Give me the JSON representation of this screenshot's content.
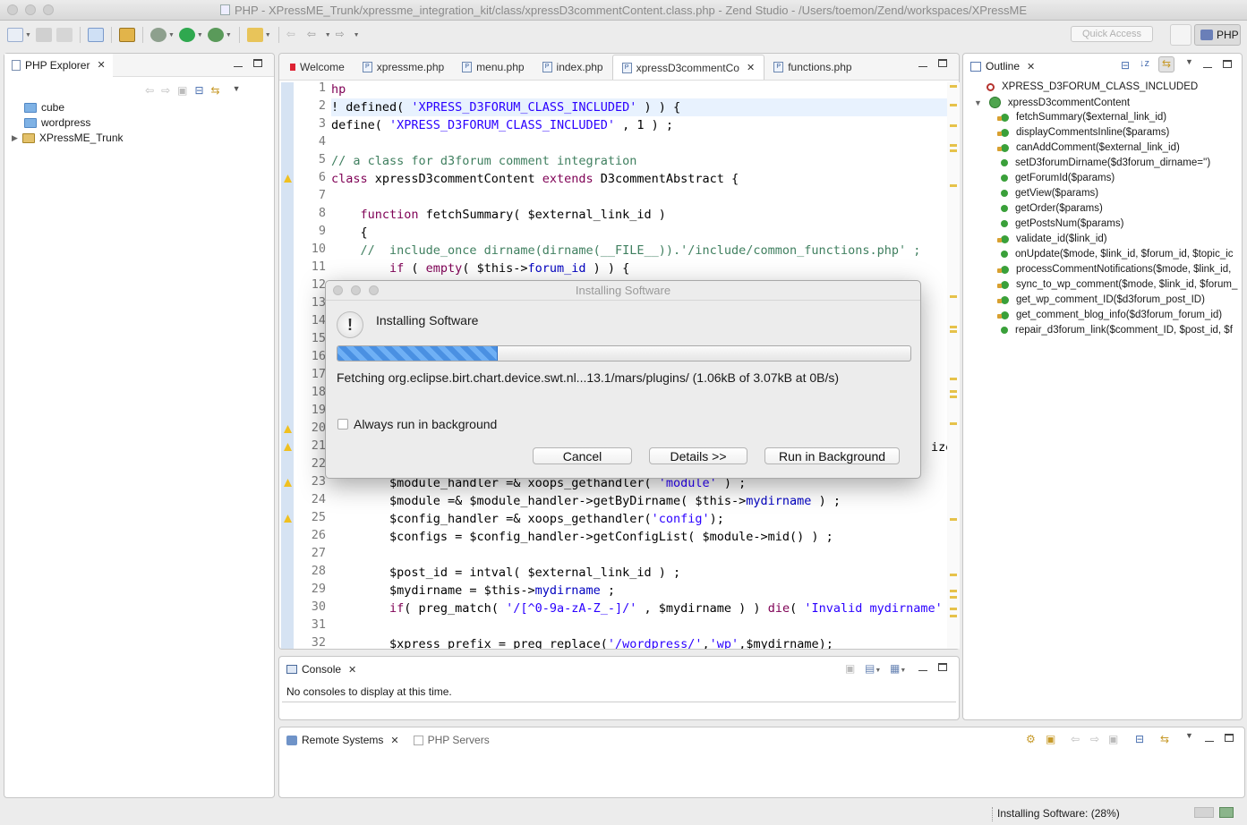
{
  "window": {
    "title": "PHP - XPressME_Trunk/xpressme_integration_kit/class/xpressD3commentContent.class.php - Zend Studio - /Users/toemon/Zend/workspaces/XPressME"
  },
  "toolbar": {
    "quick_access_placeholder": "Quick Access",
    "perspective_label": "PHP"
  },
  "explorer": {
    "tab_label": "PHP Explorer",
    "items": [
      {
        "label": "cube",
        "icon": "folder-icon"
      },
      {
        "label": "wordpress",
        "icon": "folder-icon"
      },
      {
        "label": "XPressME_Trunk",
        "icon": "project-icon"
      }
    ]
  },
  "editor": {
    "tabs": [
      {
        "label": "Welcome"
      },
      {
        "label": "xpressme.php"
      },
      {
        "label": "menu.php"
      },
      {
        "label": "index.php"
      },
      {
        "label": "xpressD3commentCo",
        "active": true
      },
      {
        "label": "functions.php"
      }
    ],
    "line_numbers": [
      "1",
      "2",
      "3",
      "4",
      "5",
      "6",
      "7",
      "8",
      "9",
      "10",
      "11",
      "12",
      "13",
      "14",
      "15",
      "16",
      "17",
      "18",
      "19",
      "20",
      "21",
      "22",
      "23",
      "24",
      "25",
      "26",
      "27",
      "28",
      "29",
      "30",
      "31",
      "32"
    ],
    "code": {
      "l1": "hp",
      "l2a": "! defined( ",
      "l2b": "'XPRESS_D3FORUM_CLASS_INCLUDED'",
      "l2c": " ) ) {",
      "l3a": "define( ",
      "l3b": "'XPRESS_D3FORUM_CLASS_INCLUDED'",
      "l3c": " , 1 ) ;",
      "l5": "// a class for d3forum comment integration",
      "l6a": "class",
      "l6b": " xpressD3commentContent ",
      "l6c": "extends",
      "l6d": " D3commentAbstract {",
      "l8a": "    function",
      "l8b": " fetchSummary( $external_link_id )",
      "l9": "    {",
      "l10": "    //  include_once dirname(dirname(__FILE__)).'/include/common_functions.php' ;",
      "l11a": "        if",
      "l11b": " ( ",
      "l11c": "empty",
      "l11d": "( $this->",
      "l11e": "forum_id",
      "l11f": " ) ) {",
      "l21tail": "izer",
      "l23a": "        $module_handler =& xoops_gethandler( ",
      "l23b": "'module'",
      "l23c": " ) ;",
      "l24a": "        $module =& $module_handler->getByDirname( $this->",
      "l24b": "mydirname",
      "l24c": " ) ;",
      "l25a": "        $config_handler =& xoops_gethandler(",
      "l25b": "'config'",
      "l25c": ");",
      "l26": "        $configs = $config_handler->getConfigList( $module->mid() ) ;",
      "l28": "        $post_id = intval( $external_link_id ) ;",
      "l29a": "        $mydirname = $this->",
      "l29b": "mydirname",
      "l29c": " ;",
      "l30a": "        if",
      "l30b": "( preg_match( ",
      "l30c": "'/[^0-9a-zA-Z_-]/'",
      "l30d": " , $mydirname ) ) ",
      "l30e": "die",
      "l30f": "( ",
      "l30g": "'Invalid mydirname'",
      "l30h": " )",
      "l32a": "        $xpress_prefix = preg_replace(",
      "l32b": "'/wordpress/'",
      "l32c": ",",
      "l32d": "'wp'",
      "l32e": ",$mydirname);"
    }
  },
  "console": {
    "tab_label": "Console",
    "message": "No consoles to display at this time."
  },
  "bottom": {
    "tab_remote": "Remote Systems",
    "tab_servers": "PHP Servers"
  },
  "outline": {
    "tab_label": "Outline",
    "constant": "XPRESS_D3FORUM_CLASS_INCLUDED",
    "class_name": "xpressD3commentContent",
    "methods": [
      "fetchSummary($external_link_id)",
      "displayCommentsInline($params)",
      "canAddComment($external_link_id)",
      "setD3forumDirname($d3forum_dirname='')",
      "getForumId($params)",
      "getView($params)",
      "getOrder($params)",
      "getPostsNum($params)",
      "validate_id($link_id)",
      "onUpdate($mode, $link_id, $forum_id, $topic_ic",
      "processCommentNotifications($mode, $link_id,",
      "sync_to_wp_comment($mode, $link_id, $forum_",
      "get_wp_comment_ID($d3forum_post_ID)",
      "get_comment_blog_info($d3forum_forum_id)",
      "repair_d3forum_link($comment_ID, $post_id, $f"
    ]
  },
  "dialog": {
    "window_title": "Installing Software",
    "heading": "Installing Software",
    "progress": 0.28,
    "status_text": "Fetching org.eclipse.birt.chart.device.swt.nl...13.1/mars/plugins/ (1.06kB of 3.07kB at 0B/s)",
    "checkbox_label": "Always run in background",
    "buttons": {
      "cancel": "Cancel",
      "details": "Details >>",
      "run_background": "Run in Background"
    }
  },
  "statusbar": {
    "text": "Installing Software: (28%)"
  },
  "colors": {
    "keyword": "#7f0055",
    "string": "#2a00ff",
    "comment": "#3f7f5f",
    "field": "#0000c0",
    "progress": "#4a90e2"
  }
}
